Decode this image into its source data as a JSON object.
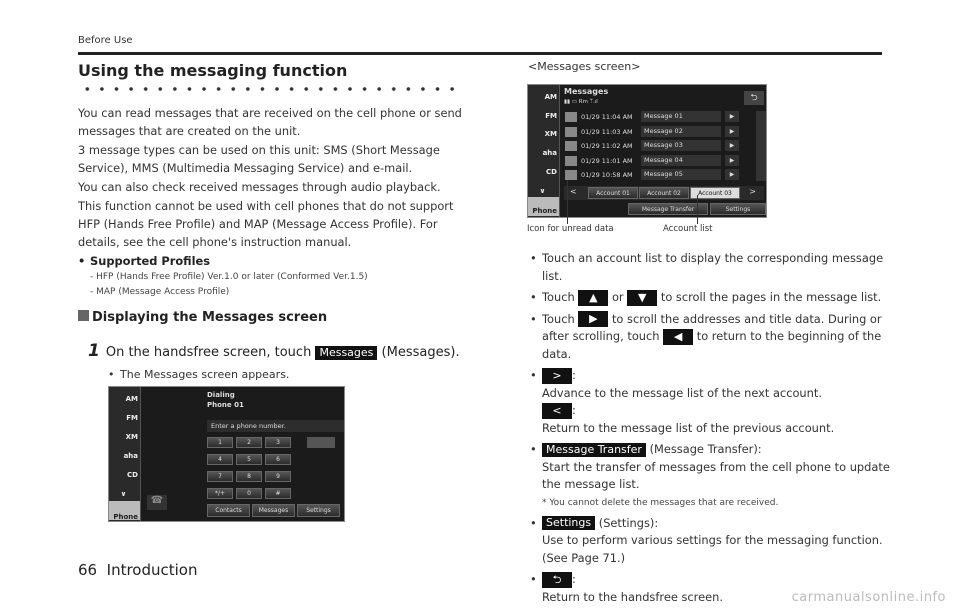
{
  "header": {
    "section": "Before Use"
  },
  "title": "Using the messaging function",
  "intro": [
    "You can read messages that are received on the cell phone or send messages that are created on the unit.",
    "3 message types can be used on this unit: SMS (Short Message Service), MMS (Multimedia Messaging Service) and e-mail.",
    "You can also check received messages through audio playback.",
    "This function cannot be used with cell phones that do not support HFP (Hands Free Profile) and MAP (Message Access Profile). For details, see the cell phone's instruction manual."
  ],
  "profiles": {
    "label": "Supported Profiles",
    "items": [
      "HFP (Hands Free Profile) Ver.1.0 or later (Conformed Ver.1.5)",
      "MAP (Message Access Profile)"
    ]
  },
  "section": {
    "heading": "Displaying the Messages screen",
    "step": {
      "number": "1",
      "text_before": "On the handsfree screen, touch",
      "button": "Messages",
      "text_after": "(Messages)."
    },
    "note": "The Messages screen appears."
  },
  "dialing_screen": {
    "title": "Dialing",
    "phone": "Phone 01",
    "prompt": "Enter a phone number.",
    "keys": [
      "1",
      "2",
      "3",
      "4",
      "5",
      "6",
      "7",
      "8",
      "9",
      "*/+",
      "0",
      "#"
    ],
    "buttons": [
      "Contacts",
      "Messages",
      "Settings"
    ],
    "sources": [
      "AM",
      "FM",
      "XM",
      "aha",
      "CD",
      "∨",
      "Phone"
    ]
  },
  "messages_caption": "<Messages screen>",
  "messages_screen": {
    "title": "Messages",
    "status": "Rm",
    "rows": [
      {
        "time": "01/29 11:04 AM",
        "title": "Message 01"
      },
      {
        "time": "01/29 11:03 AM",
        "title": "Message 02"
      },
      {
        "time": "01/29 11:02 AM",
        "title": "Message 03"
      },
      {
        "time": "01/29 11:01 AM",
        "title": "Message 04"
      },
      {
        "time": "01/29 10:58 AM",
        "title": "Message 05"
      }
    ],
    "accounts": [
      "Account 01",
      "Account 02",
      "Account 03"
    ],
    "selected_account": "Account 03",
    "buttons": [
      "Message Transfer",
      "Settings"
    ],
    "callout_unread": "Icon for unread data",
    "callout_account": "Account list"
  },
  "bullets": {
    "b1": "Touch an account list to display the corresponding message list.",
    "b2a": "Touch",
    "b2b": "or",
    "b2c": "to scroll the pages in the message list.",
    "b3a": "Touch",
    "b3b": "to scroll the addresses and title data. During or after scrolling, touch",
    "b3c": "to return to the beginning of the data.",
    "next_desc": "Advance to the message list of the next account.",
    "prev_desc": "Return to the message list of the previous account.",
    "transfer_btn": "Message Transfer",
    "transfer_paren": "(Message Transfer):",
    "transfer_desc": "Start the transfer of messages from the cell phone to update the message list.",
    "transfer_note": "*  You cannot delete the messages that are received.",
    "settings_btn": "Settings",
    "settings_paren": "(Settings):",
    "settings_desc": "Use to perform various settings for the messaging function. (See Page 71.)",
    "back_desc": "Return to the handsfree screen."
  },
  "footer": {
    "page": "66",
    "chapter": "Introduction"
  },
  "watermark": "carmanualsonline.info"
}
